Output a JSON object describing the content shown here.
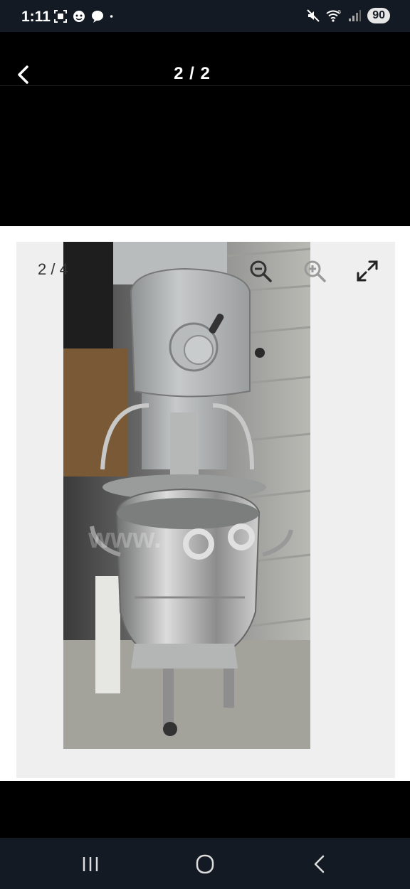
{
  "status_bar": {
    "time": "1:11",
    "battery": "90",
    "left_icons": [
      "screenshot-icon",
      "face-icon",
      "chat-icon",
      "dot-icon"
    ],
    "right_icons": [
      "mute-icon",
      "wifi-icon",
      "signal-icon"
    ]
  },
  "header": {
    "title": "2 / 2"
  },
  "viewer": {
    "counter": "2 / 4",
    "watermark": "www.",
    "tools": [
      "zoom-out-icon",
      "zoom-in-icon",
      "fullscreen-icon"
    ]
  },
  "navbar": {
    "buttons": [
      "recents-button",
      "home-button",
      "back-button"
    ]
  },
  "colors": {
    "status_bg": "#141a24",
    "viewer_bg": "#efefef",
    "page_bg": "#000000"
  }
}
